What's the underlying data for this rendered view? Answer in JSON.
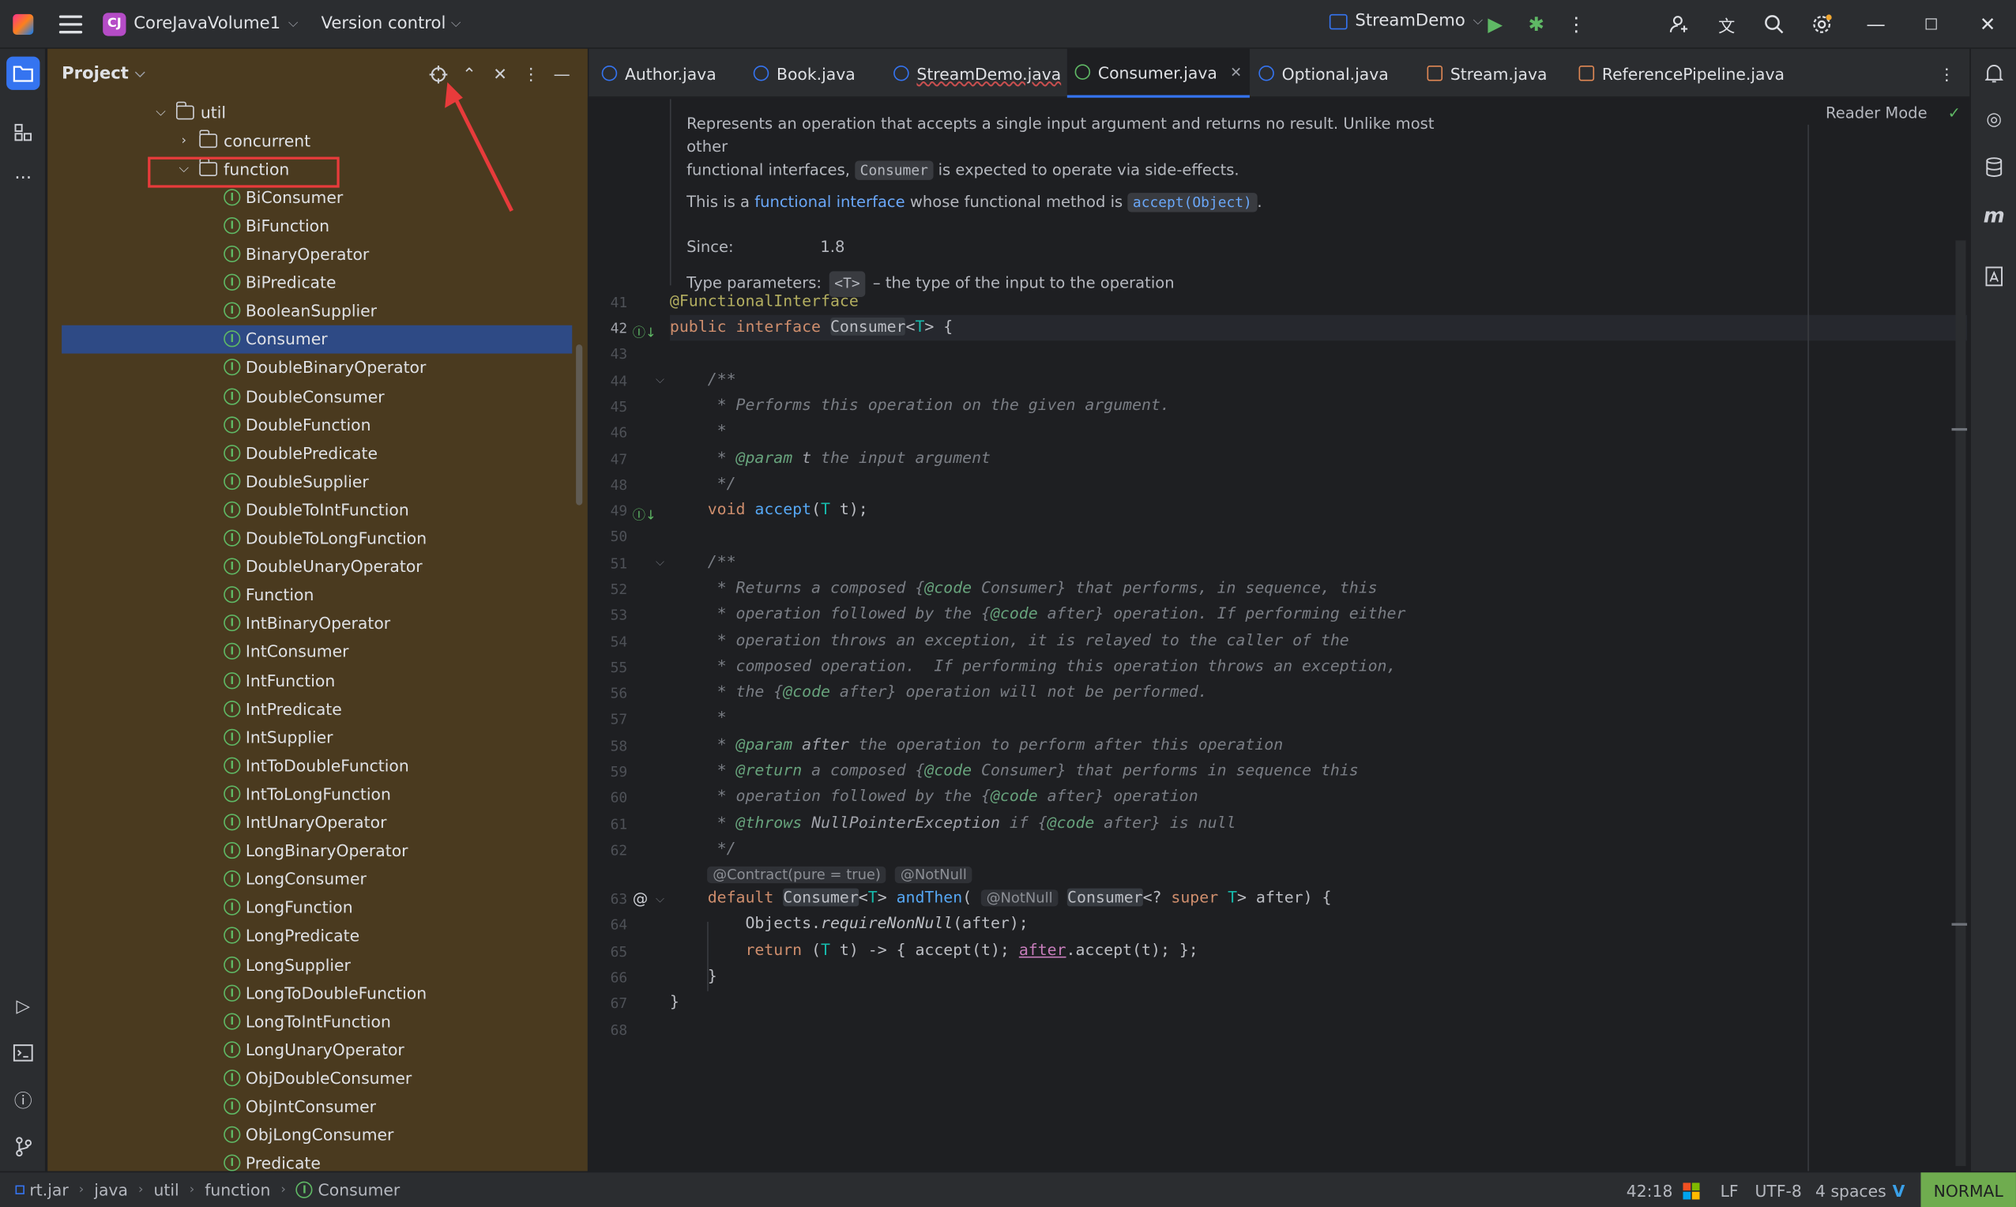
{
  "titlebar": {
    "project_badge": "CJ",
    "project_name": "CoreJavaVolume1",
    "vcs": "Version control",
    "run_config": "StreamDemo"
  },
  "project_panel": {
    "title": "Project",
    "tree": [
      {
        "label": "util",
        "type": "folder",
        "expanded": true,
        "indent": 1
      },
      {
        "label": "concurrent",
        "type": "folder",
        "expanded": false,
        "indent": 2
      },
      {
        "label": "function",
        "type": "folder",
        "expanded": true,
        "indent": 2
      },
      {
        "label": "BiConsumer",
        "type": "interface",
        "indent": 3
      },
      {
        "label": "BiFunction",
        "type": "interface",
        "indent": 3
      },
      {
        "label": "BinaryOperator",
        "type": "interface",
        "indent": 3
      },
      {
        "label": "BiPredicate",
        "type": "interface",
        "indent": 3
      },
      {
        "label": "BooleanSupplier",
        "type": "interface",
        "indent": 3
      },
      {
        "label": "Consumer",
        "type": "interface",
        "indent": 3,
        "selected": true
      },
      {
        "label": "DoubleBinaryOperator",
        "type": "interface",
        "indent": 3
      },
      {
        "label": "DoubleConsumer",
        "type": "interface",
        "indent": 3
      },
      {
        "label": "DoubleFunction",
        "type": "interface",
        "indent": 3
      },
      {
        "label": "DoublePredicate",
        "type": "interface",
        "indent": 3
      },
      {
        "label": "DoubleSupplier",
        "type": "interface",
        "indent": 3
      },
      {
        "label": "DoubleToIntFunction",
        "type": "interface",
        "indent": 3
      },
      {
        "label": "DoubleToLongFunction",
        "type": "interface",
        "indent": 3
      },
      {
        "label": "DoubleUnaryOperator",
        "type": "interface",
        "indent": 3
      },
      {
        "label": "Function",
        "type": "interface",
        "indent": 3
      },
      {
        "label": "IntBinaryOperator",
        "type": "interface",
        "indent": 3
      },
      {
        "label": "IntConsumer",
        "type": "interface",
        "indent": 3
      },
      {
        "label": "IntFunction",
        "type": "interface",
        "indent": 3
      },
      {
        "label": "IntPredicate",
        "type": "interface",
        "indent": 3
      },
      {
        "label": "IntSupplier",
        "type": "interface",
        "indent": 3
      },
      {
        "label": "IntToDoubleFunction",
        "type": "interface",
        "indent": 3
      },
      {
        "label": "IntToLongFunction",
        "type": "interface",
        "indent": 3
      },
      {
        "label": "IntUnaryOperator",
        "type": "interface",
        "indent": 3
      },
      {
        "label": "LongBinaryOperator",
        "type": "interface",
        "indent": 3
      },
      {
        "label": "LongConsumer",
        "type": "interface",
        "indent": 3
      },
      {
        "label": "LongFunction",
        "type": "interface",
        "indent": 3
      },
      {
        "label": "LongPredicate",
        "type": "interface",
        "indent": 3
      },
      {
        "label": "LongSupplier",
        "type": "interface",
        "indent": 3
      },
      {
        "label": "LongToDoubleFunction",
        "type": "interface",
        "indent": 3
      },
      {
        "label": "LongToIntFunction",
        "type": "interface",
        "indent": 3
      },
      {
        "label": "LongUnaryOperator",
        "type": "interface",
        "indent": 3
      },
      {
        "label": "ObjDoubleConsumer",
        "type": "interface",
        "indent": 3
      },
      {
        "label": "ObjIntConsumer",
        "type": "interface",
        "indent": 3
      },
      {
        "label": "ObjLongConsumer",
        "type": "interface",
        "indent": 3
      },
      {
        "label": "Predicate",
        "type": "interface",
        "indent": 3
      }
    ]
  },
  "tabs": [
    {
      "label": "Author.java",
      "icon": "class-icon"
    },
    {
      "label": "Book.java",
      "icon": "class-icon"
    },
    {
      "label": "StreamDemo.java",
      "icon": "class-icon"
    },
    {
      "label": "Consumer.java",
      "icon": "interface-icon",
      "active": true
    },
    {
      "label": "Optional.java",
      "icon": "class-icon"
    },
    {
      "label": "Stream.java",
      "icon": "jar-icon"
    },
    {
      "label": "ReferencePipeline.java",
      "icon": "jar-icon"
    }
  ],
  "editor": {
    "reader_mode": "Reader Mode",
    "doc": {
      "line1": "Represents an operation that accepts a single input argument and returns no result. Unlike most other",
      "line2a": "functional interfaces, ",
      "line2code": "Consumer",
      "line2b": " is expected to operate via side-effects.",
      "line3a": "This is a ",
      "line3link": "functional interface",
      "line3b": " whose functional method is ",
      "line3code": "accept(Object)",
      "line3c": ".",
      "since_label": "Since:",
      "since_value": "1.8",
      "typeparams_label": "Type parameters:",
      "typeparams_code": "<T>",
      "typeparams_text": "– the type of the input to the operation"
    },
    "line_numbers": [
      "41",
      "42",
      "43",
      "44",
      "45",
      "46",
      "47",
      "48",
      "49",
      "50",
      "51",
      "52",
      "53",
      "54",
      "55",
      "56",
      "57",
      "58",
      "59",
      "60",
      "61",
      "62",
      "63",
      "64",
      "65",
      "66",
      "67",
      "68"
    ],
    "inlay_contract": "@Contract(pure = true)",
    "inlay_notnull": "@NotNull",
    "inlay_notnull2": "@NotNull"
  },
  "statusbar": {
    "crumbs": [
      "rt.jar",
      "java",
      "util",
      "function",
      "Consumer"
    ],
    "position": "42:18",
    "line_sep": "LF",
    "encoding": "UTF-8",
    "indent": "4 spaces",
    "mode": "NORMAL"
  }
}
